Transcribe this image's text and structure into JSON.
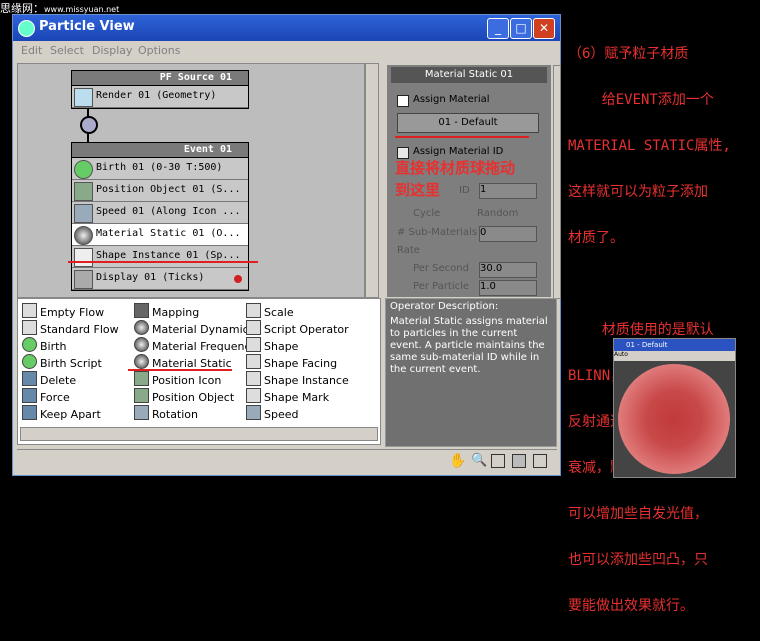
{
  "banner": {
    "text": "思缘网：",
    "url": "www.missyuan.net"
  },
  "window": {
    "title": "Particle View",
    "menu": [
      "Edit",
      "Select",
      "Display",
      "Options"
    ],
    "controls": {
      "minimize": "_",
      "maximize": "□",
      "close": "✕"
    }
  },
  "nodes": {
    "pf_source": {
      "title": "PF Source 01",
      "rows": [
        "Render 01 (Geometry)"
      ]
    },
    "event": {
      "title": "Event 01",
      "rows": [
        "Birth 01 (0-30 T:500)",
        "Position Object 01 (S...",
        "Speed 01 (Along Icon ...",
        "Material Static 01 (O...",
        "Shape Instance 01 (Sp...",
        "Display 01 (Ticks)"
      ]
    }
  },
  "params": {
    "rollout": "Material Static 01",
    "assign_material": "Assign Material",
    "material_button": "01 - Default",
    "assign_material_id": "Assign Material ID",
    "show_in_viewport_trunc": "ID",
    "material_id_value": "1",
    "cycle": "Cycle",
    "random": "Random",
    "sub_materials": "# Sub-Materials",
    "sub_materials_value": "0",
    "rate_group": "Rate",
    "per_second": "Per Second",
    "per_second_value": "30.0",
    "per_particle": "Per Particle",
    "per_particle_value": "1.0",
    "overlay_annotation_line1": "直接将材质球拖动",
    "overlay_annotation_line2": "到这里"
  },
  "depot": {
    "col1": [
      "Empty Flow",
      "Standard Flow",
      "Birth",
      "Birth Script",
      "Delete",
      "Force",
      "Keep Apart"
    ],
    "col2": [
      "Mapping",
      "Material Dynamic",
      "Material Frequency",
      "Material Static",
      "Position Icon",
      "Position Object",
      "Rotation"
    ],
    "col3": [
      "Scale",
      "Script Operator",
      "Shape",
      "Shape Facing",
      "Shape Instance",
      "Shape Mark",
      "Speed"
    ]
  },
  "description": {
    "header": "Operator Description:",
    "body": "Material Static assigns material to particles in the current event.  A particle maintains the same sub-material ID while in the current event."
  },
  "side_text": {
    "line1": "（6）赋予粒子材质",
    "line2": "    给EVENT添加一个",
    "line3": "MATERIAL STATIC属性,",
    "line4": "这样就可以为粒子添加",
    "line5": "材质了。",
    "line6": "    材质使用的是默认",
    "line7": "BLINN，颜色改为暗红，",
    "line8": "反射通道添加FALL OFF",
    "line9": "衰减，默认值就行。也",
    "line10": "可以增加些自发光值，",
    "line11": "也可以添加些凹凸，只",
    "line12": "要能做出效果就行。"
  },
  "material_preview": {
    "title": "01 - Default",
    "toolbar": "Auto"
  },
  "colors": {
    "accent_red": "#e02020",
    "titlebar": "#2f63d8"
  }
}
